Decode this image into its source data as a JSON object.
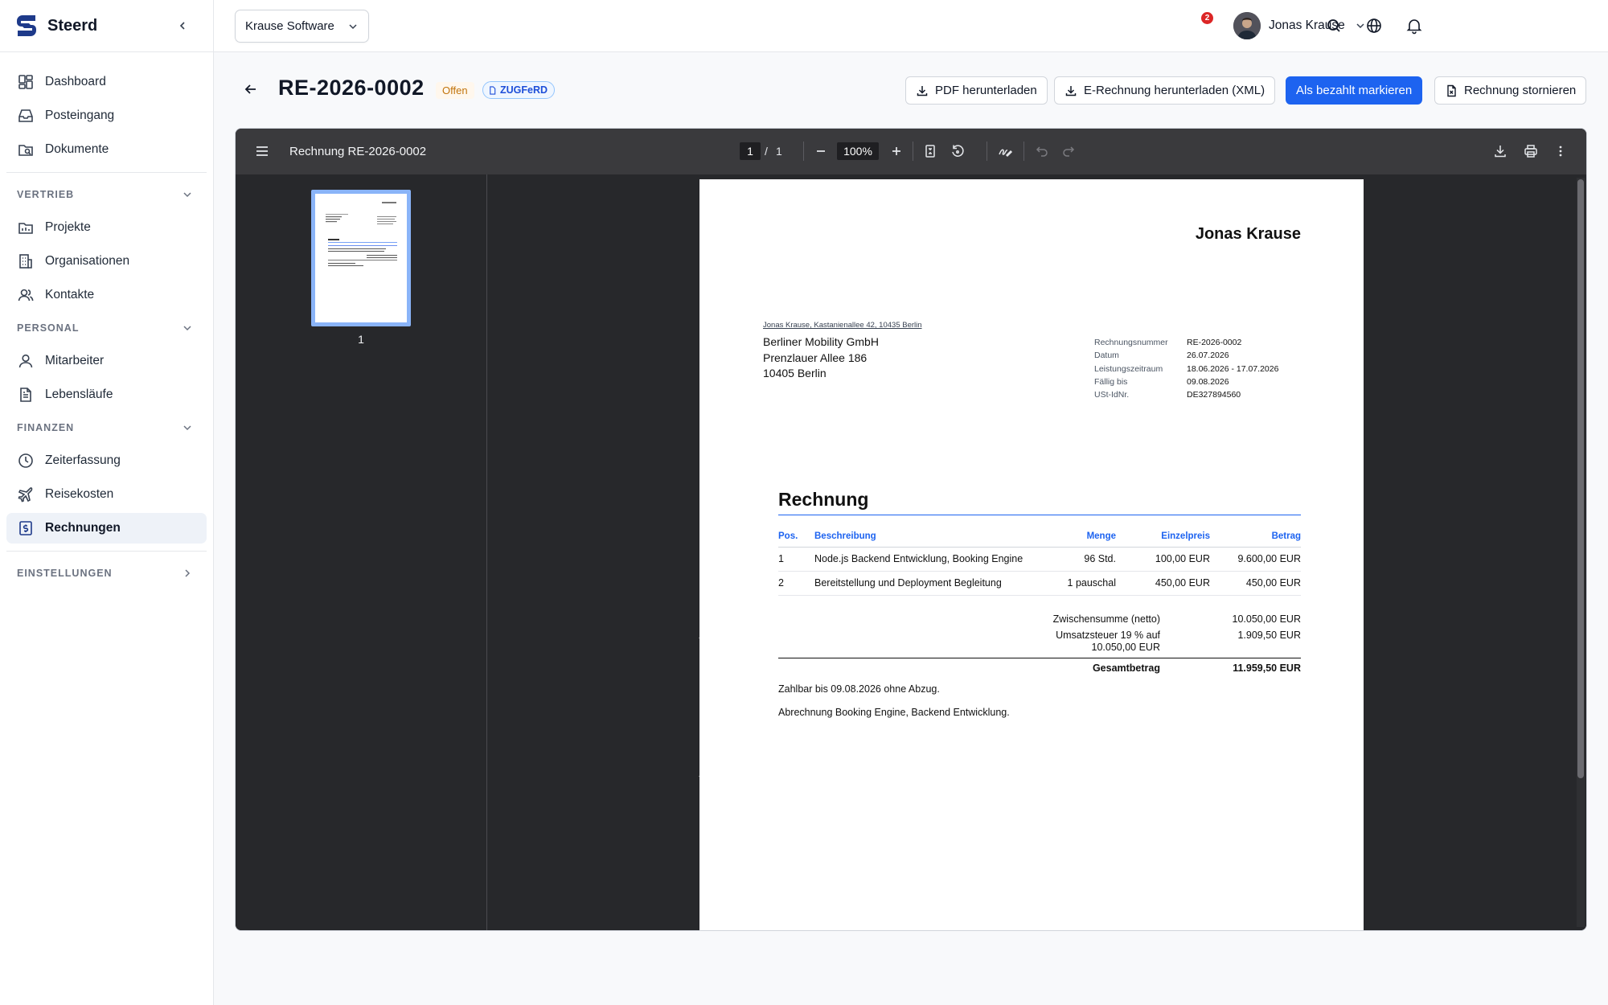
{
  "app": {
    "name": "Steerd"
  },
  "sidebar": {
    "top_items": [
      {
        "label": "Dashboard",
        "icon": "dashboard-icon"
      },
      {
        "label": "Posteingang",
        "icon": "inbox-icon"
      },
      {
        "label": "Dokumente",
        "icon": "documents-icon"
      }
    ],
    "sections": {
      "vertrieb": {
        "label": "VERTRIEB",
        "items": [
          {
            "label": "Projekte"
          },
          {
            "label": "Organisationen"
          },
          {
            "label": "Kontakte"
          }
        ]
      },
      "personal": {
        "label": "PERSONAL",
        "items": [
          {
            "label": "Mitarbeiter"
          },
          {
            "label": "Lebensläufe"
          }
        ]
      },
      "finanzen": {
        "label": "FINANZEN",
        "items": [
          {
            "label": "Zeiterfassung"
          },
          {
            "label": "Reisekosten"
          },
          {
            "label": "Rechnungen"
          }
        ]
      },
      "einstellungen": {
        "label": "EINSTELLUNGEN"
      }
    },
    "active_item": "Rechnungen"
  },
  "topbar": {
    "org_select": "Krause Software",
    "notifications_count": "2",
    "user_name": "Jonas Krause"
  },
  "header": {
    "title": "RE-2026-0002",
    "status": "Offen",
    "badge": "ZUGFeRD",
    "buttons": {
      "pdf": "PDF herunterladen",
      "erechnung": "E-Rechnung herunterladen (XML)",
      "paid": "Als bezahlt markieren",
      "cancel": "Rechnung stornieren"
    }
  },
  "viewer": {
    "doc_title": "Rechnung RE-2026-0002",
    "page_current": "1",
    "page_sep": "/",
    "page_total": "1",
    "zoom": "100%",
    "thumb_label": "1"
  },
  "invoice": {
    "issuer_name": "Jonas Krause",
    "sender_line": "Jonas Krause, Kastanienallee 42, 10435 Berlin",
    "recipient": {
      "line1": "Berliner Mobility GmbH",
      "line2": "Prenzlauer Allee 186",
      "line3": "10405 Berlin"
    },
    "meta": [
      {
        "k": "Rechnungsnummer",
        "v": "RE-2026-0002"
      },
      {
        "k": "Datum",
        "v": "26.07.2026"
      },
      {
        "k": "Leistungszeitraum",
        "v": "18.06.2026 - 17.07.2026"
      },
      {
        "k": "Fällig bis",
        "v": "09.08.2026"
      },
      {
        "k": "USt-IdNr.",
        "v": "DE327894560"
      }
    ],
    "heading": "Rechnung",
    "columns": {
      "pos": "Pos.",
      "desc": "Beschreibung",
      "qty": "Menge",
      "unit": "Einzelpreis",
      "amount": "Betrag"
    },
    "items": [
      {
        "pos": "1",
        "desc": "Node.js Backend Entwicklung, Booking Engine",
        "qty": "96 Std.",
        "unit": "100,00 EUR",
        "amount": "9.600,00 EUR"
      },
      {
        "pos": "2",
        "desc": "Bereitstellung und Deployment Begleitung",
        "qty": "1 pauschal",
        "unit": "450,00 EUR",
        "amount": "450,00 EUR"
      }
    ],
    "subtotal_label": "Zwischensumme (netto)",
    "subtotal_value": "10.050,00 EUR",
    "tax_label_1": "Umsatzsteuer 19 % auf",
    "tax_label_2": "10.050,00 EUR",
    "tax_value": "1.909,50 EUR",
    "total_label": "Gesamtbetrag",
    "total_value": "11.959,50 EUR",
    "note_1": "Zahlbar bis 09.08.2026 ohne Abzug.",
    "note_2": "Abrechnung Booking Engine, Backend Entwicklung."
  },
  "colors": {
    "primary": "#1d63f0",
    "viewer_bg": "#27282b",
    "status": "#c2740c"
  }
}
